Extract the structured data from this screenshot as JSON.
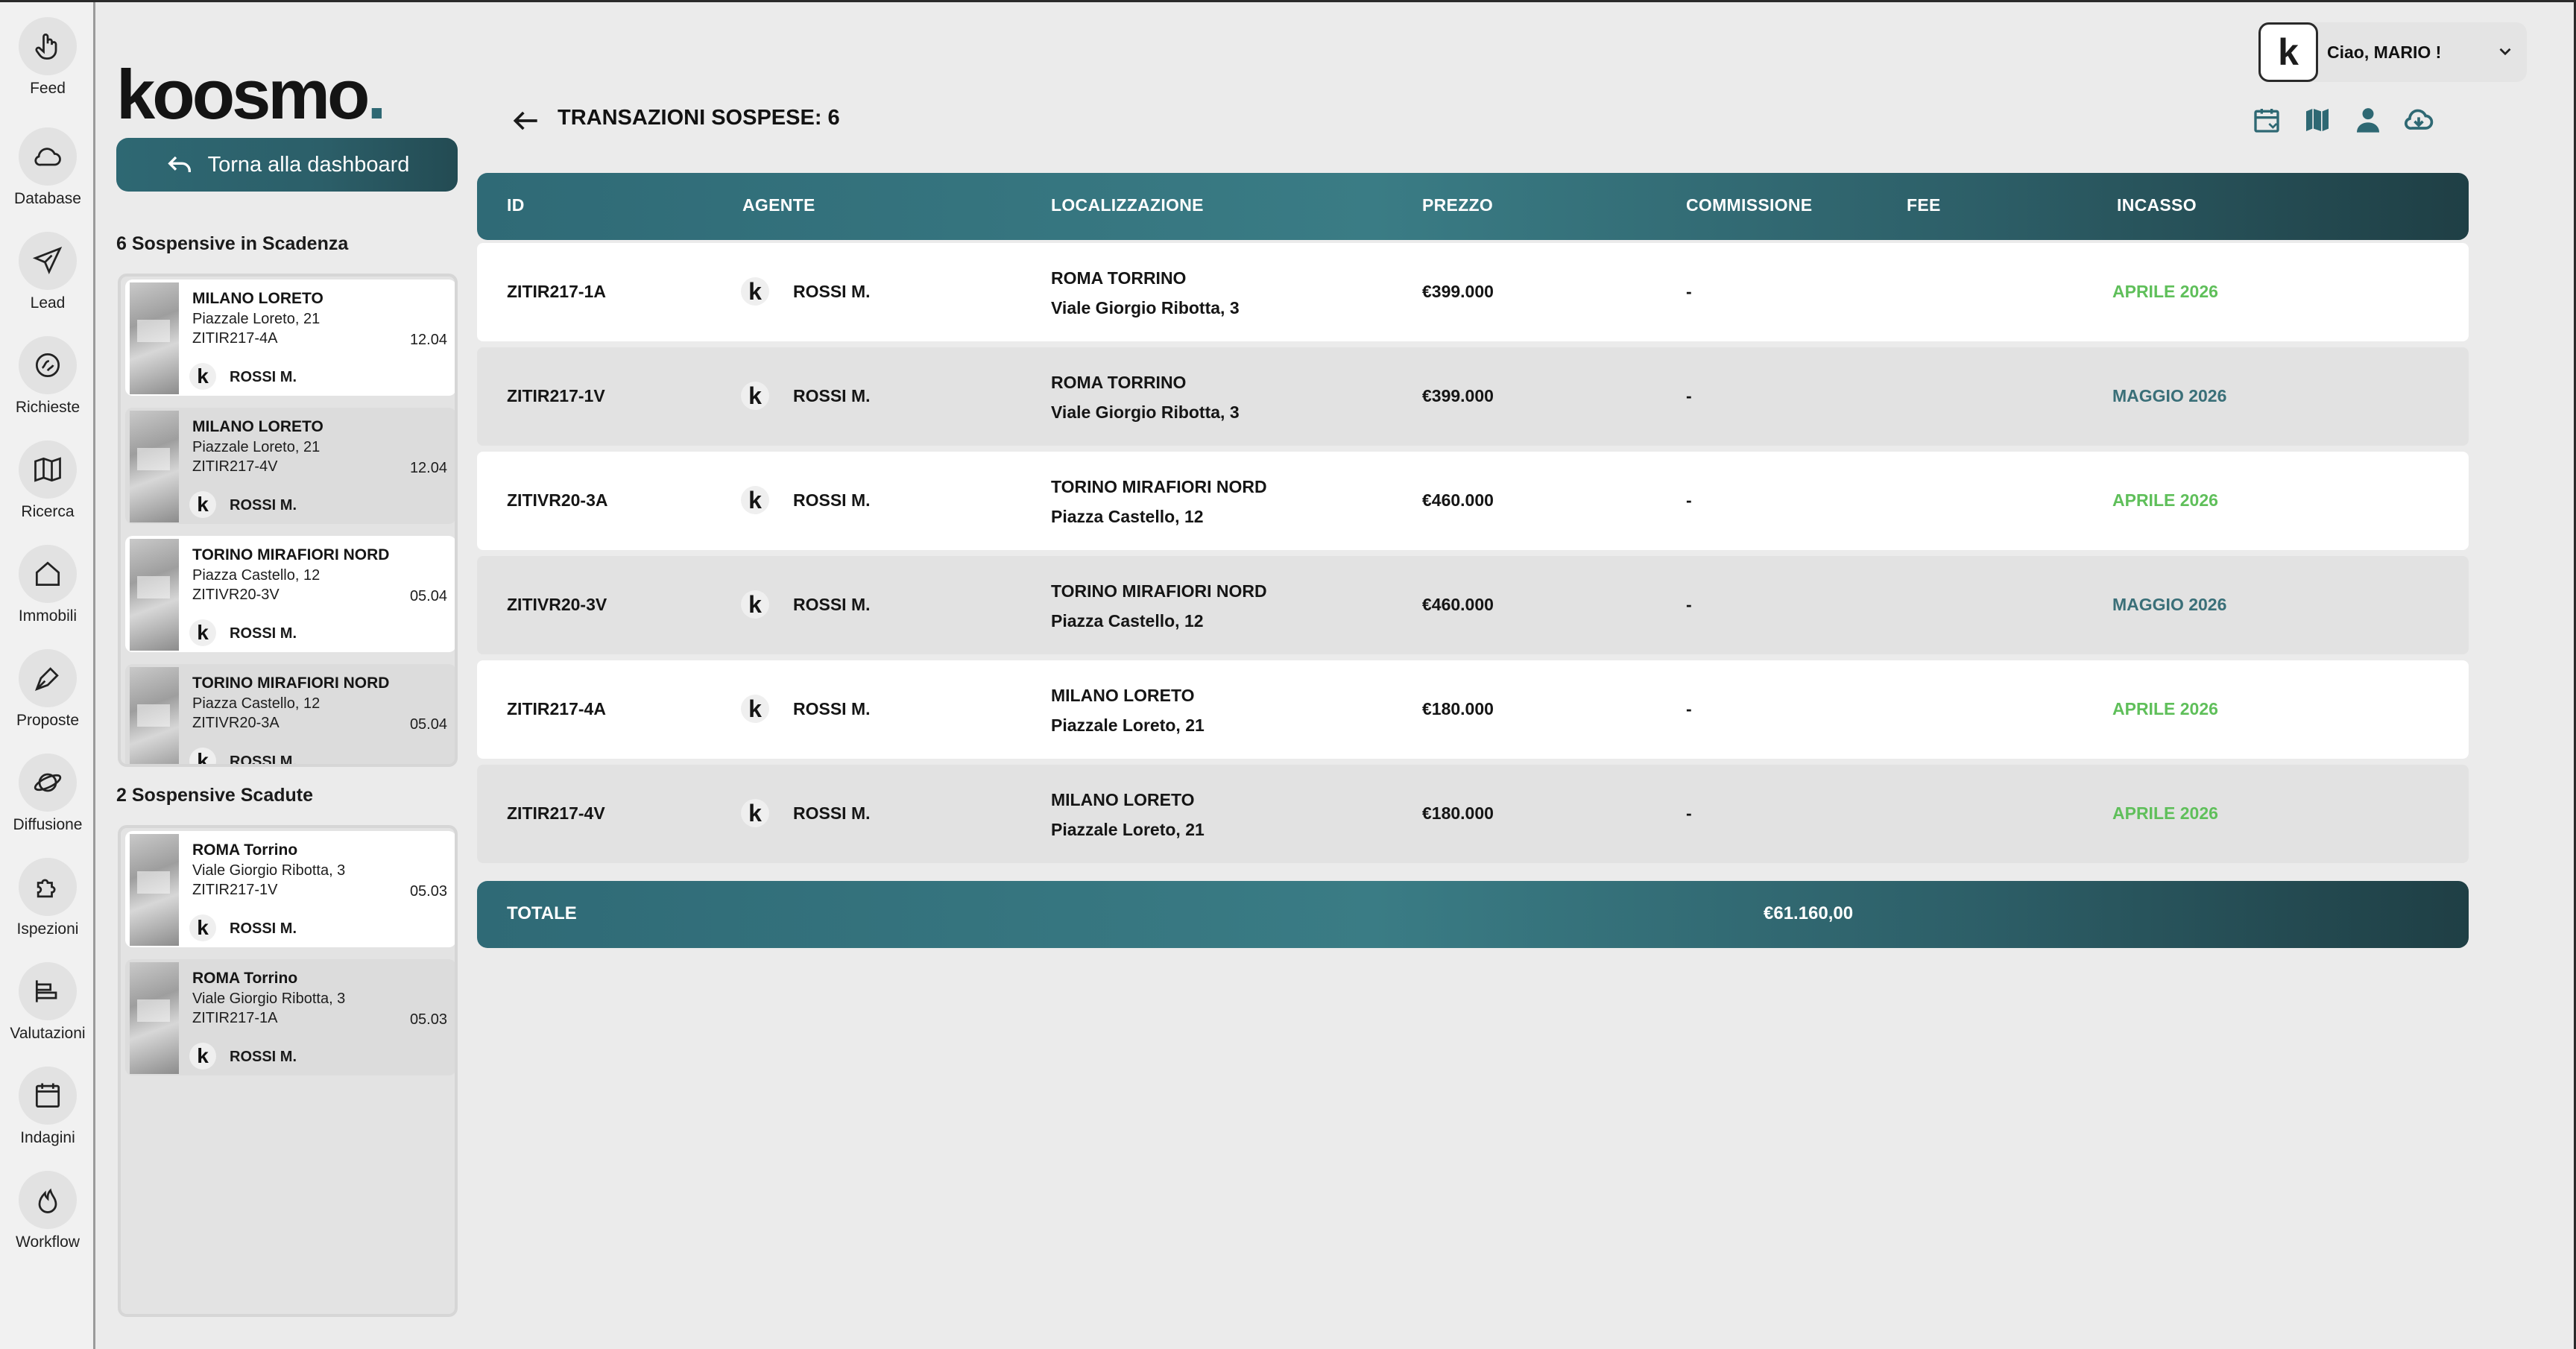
{
  "rail": {
    "items": [
      {
        "label": "Feed",
        "icon": "hand-pointer-icon"
      },
      {
        "label": "Database",
        "icon": "cloud-icon"
      },
      {
        "label": "Lead",
        "icon": "paper-plane-icon"
      },
      {
        "label": "Richieste",
        "icon": "richieste-icon"
      },
      {
        "label": "Ricerca",
        "icon": "map-icon"
      },
      {
        "label": "Immobili",
        "icon": "home-icon"
      },
      {
        "label": "Proposte",
        "icon": "pen-icon"
      },
      {
        "label": "Diffusione",
        "icon": "planet-icon"
      },
      {
        "label": "Ispezioni",
        "icon": "puzzle-icon"
      },
      {
        "label": "Valutazioni",
        "icon": "bars-icon"
      },
      {
        "label": "Indagini",
        "icon": "calendar-icon"
      },
      {
        "label": "Workflow",
        "icon": "flame-icon"
      }
    ]
  },
  "sidebar": {
    "logo": "koosmo",
    "logo_dot": ".",
    "back_label": "Torna alla dashboard",
    "scadenza_title": "6 Sospensive in Scadenza",
    "scadute_title": "2 Sospensive Scadute",
    "scadenza_cards": [
      {
        "city": "MILANO LORETO",
        "address": "Piazzale Loreto, 21",
        "code": "ZITIR217-4A",
        "date": "12.04",
        "agent": "ROSSI M."
      },
      {
        "city": "MILANO LORETO",
        "address": "Piazzale Loreto, 21",
        "code": "ZITIR217-4V",
        "date": "12.04",
        "agent": "ROSSI M."
      },
      {
        "city": "TORINO MIRAFIORI NORD",
        "address": "Piazza Castello, 12",
        "code": "ZITIVR20-3V",
        "date": "05.04",
        "agent": "ROSSI M."
      },
      {
        "city": "TORINO MIRAFIORI NORD",
        "address": "Piazza Castello, 12",
        "code": "ZITIVR20-3A",
        "date": "05.04",
        "agent": "ROSSI M."
      }
    ],
    "scadute_cards": [
      {
        "city": "ROMA Torrino",
        "address": "Viale Giorgio Ribotta, 3",
        "code": "ZITIR217-1V",
        "date": "05.03",
        "agent": "ROSSI M."
      },
      {
        "city": "ROMA Torrino",
        "address": "Viale Giorgio Ribotta, 3",
        "code": "ZITIR217-1A",
        "date": "05.03",
        "agent": "ROSSI M."
      }
    ]
  },
  "header": {
    "title": "TRANSAZIONI SOSPESE: 6",
    "user_greeting": "Ciao, MARIO !",
    "user_initial": "k",
    "toolbar_icons": [
      "calendar-icon",
      "map-icon",
      "user-icon",
      "cloud-download-icon"
    ]
  },
  "table": {
    "columns": [
      "ID",
      "AGENTE",
      "LOCALIZZAZIONE",
      "PREZZO",
      "COMMISSIONE",
      "FEE",
      "INCASSO"
    ],
    "rows": [
      {
        "id": "ZITIR217-1A",
        "agent": "ROSSI M.",
        "loc_city": "ROMA  TORRINO",
        "loc_address": "Viale Giorgio Ribotta, 3",
        "price": "€399.000",
        "commission": "-",
        "fee": "",
        "incasso": "APRILE 2026",
        "incasso_color": "#5fbf5a"
      },
      {
        "id": "ZITIR217-1V",
        "agent": "ROSSI M.",
        "loc_city": "ROMA  TORRINO",
        "loc_address": "Viale Giorgio Ribotta, 3",
        "price": "€399.000",
        "commission": "-",
        "fee": "",
        "incasso": "MAGGIO 2026",
        "incasso_color": "#3a6f78"
      },
      {
        "id": "ZITIVR20-3A",
        "agent": "ROSSI M.",
        "loc_city": "TORINO  MIRAFIORI NORD",
        "loc_address": "Piazza Castello, 12",
        "price": "€460.000",
        "commission": "-",
        "fee": "",
        "incasso": "APRILE 2026",
        "incasso_color": "#5fbf5a"
      },
      {
        "id": "ZITIVR20-3V",
        "agent": "ROSSI M.",
        "loc_city": "TORINO  MIRAFIORI NORD",
        "loc_address": "Piazza Castello, 12",
        "price": "€460.000",
        "commission": "-",
        "fee": "",
        "incasso": "MAGGIO 2026",
        "incasso_color": "#3a6f78"
      },
      {
        "id": "ZITIR217-4A",
        "agent": "ROSSI M.",
        "loc_city": "MILANO  LORETO",
        "loc_address": "Piazzale Loreto, 21",
        "price": "€180.000",
        "commission": "-",
        "fee": "",
        "incasso": "APRILE 2026",
        "incasso_color": "#5fbf5a"
      },
      {
        "id": "ZITIR217-4V",
        "agent": "ROSSI M.",
        "loc_city": "MILANO  LORETO",
        "loc_address": "Piazzale Loreto, 21",
        "price": "€180.000",
        "commission": "-",
        "fee": "",
        "incasso": "APRILE 2026",
        "incasso_color": "#5fbf5a"
      }
    ],
    "total_label": "TOTALE",
    "total_value": "€61.160,00"
  },
  "colors": {
    "accent": "#2e6873",
    "incasso_green": "#5fbf5a",
    "incasso_teal": "#3a6f78"
  }
}
